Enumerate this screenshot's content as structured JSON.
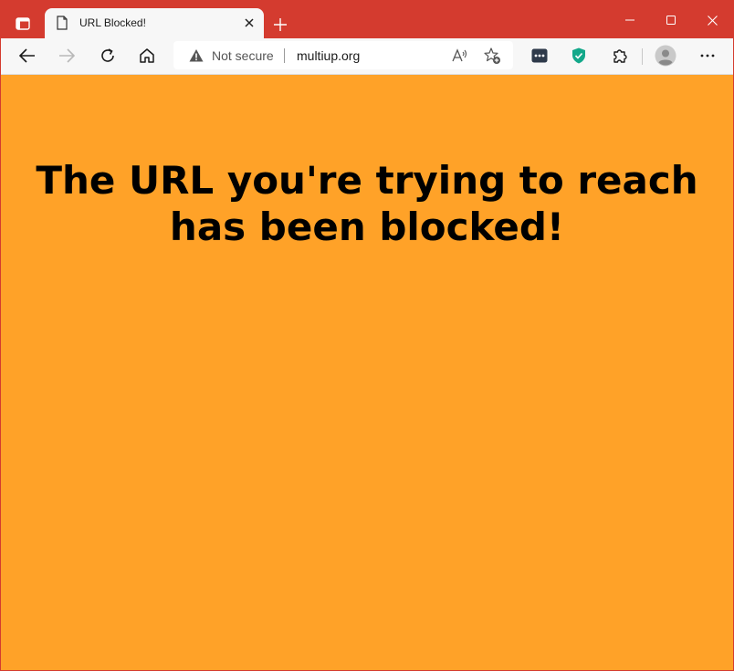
{
  "browser": {
    "tab": {
      "title": "URL Blocked!",
      "favicon": "page-icon"
    },
    "addressbar": {
      "security_label": "Not secure",
      "url": "multiup.org"
    },
    "icons": {
      "tab_actions": "tab-actions-icon",
      "close_tab": "close-icon",
      "new_tab": "plus-icon",
      "minimize": "minimize-icon",
      "maximize": "maximize-icon",
      "close_window": "close-icon",
      "back": "back-arrow-icon",
      "forward": "forward-arrow-icon",
      "refresh": "refresh-icon",
      "home": "home-icon",
      "warning": "warning-icon",
      "read_aloud": "read-aloud-icon",
      "favorites": "add-favorite-icon",
      "extension_1": "extension-dots-icon",
      "extension_2": "shield-icon",
      "extensions": "puzzle-icon",
      "profile": "avatar-icon",
      "menu": "more-icon"
    },
    "colors": {
      "titlebar": "#d43b2f",
      "toolbar": "#f7f7f7",
      "page_background": "#ffa228"
    }
  },
  "page": {
    "heading_line1": "The URL you're trying to reach",
    "heading_line2": "has been blocked!"
  }
}
